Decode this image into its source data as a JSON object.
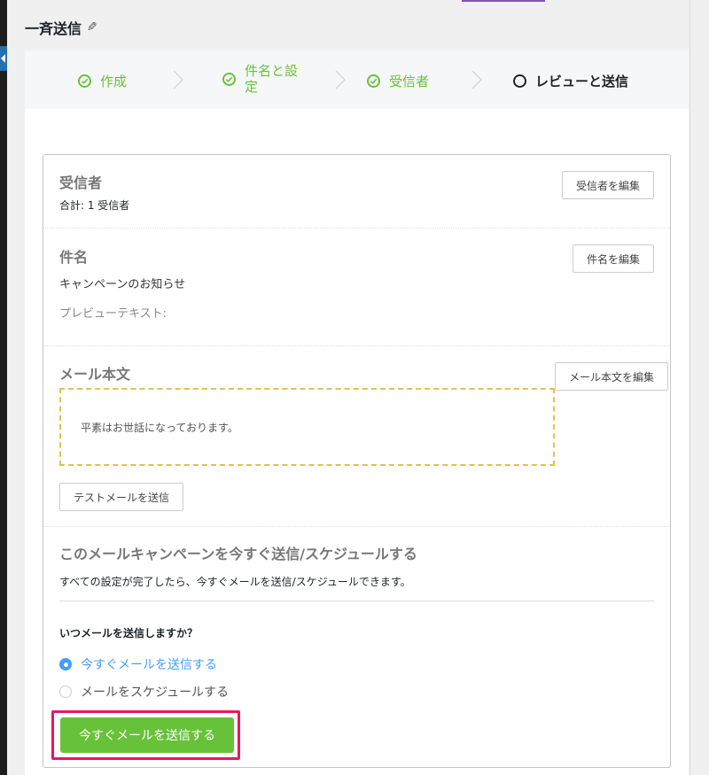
{
  "page": {
    "title": "一斉送信",
    "edit_icon": "pencil-icon"
  },
  "stepper": {
    "steps": [
      {
        "label": "作成",
        "state": "done"
      },
      {
        "label_line1": "件名と設",
        "label_line2": "定",
        "state": "done"
      },
      {
        "label": "受信者",
        "state": "done"
      },
      {
        "label": "レビューと送信",
        "state": "current"
      }
    ]
  },
  "recipients": {
    "title": "受信者",
    "total": "合計: 1 受信者",
    "edit_button": "受信者を編集"
  },
  "subject": {
    "title": "件名",
    "value": "キャンペーンのお知らせ",
    "preview_label": "プレビューテキスト:",
    "edit_button": "件名を編集"
  },
  "body": {
    "title": "メール本文",
    "edit_button": "メール本文を編集",
    "preview_text": "平素はお世話になっております。",
    "test_button": "テストメールを送信"
  },
  "schedule": {
    "title": "このメールキャンペーンを今すぐ送信/スケジュールする",
    "description": "すべての設定が完了したら、今すぐメールを送信/スケジュールできます。",
    "question": "いつメールを送信しますか？",
    "options": [
      {
        "label": "今すぐメールを送信する",
        "selected": true
      },
      {
        "label": "メールをスケジュールする",
        "selected": false
      }
    ],
    "submit_button": "今すぐメールを送信する"
  },
  "colors": {
    "success": "#67c23a",
    "primary": "#409eff",
    "highlight": "#e8175d",
    "dashed_border": "#e1c24a"
  }
}
